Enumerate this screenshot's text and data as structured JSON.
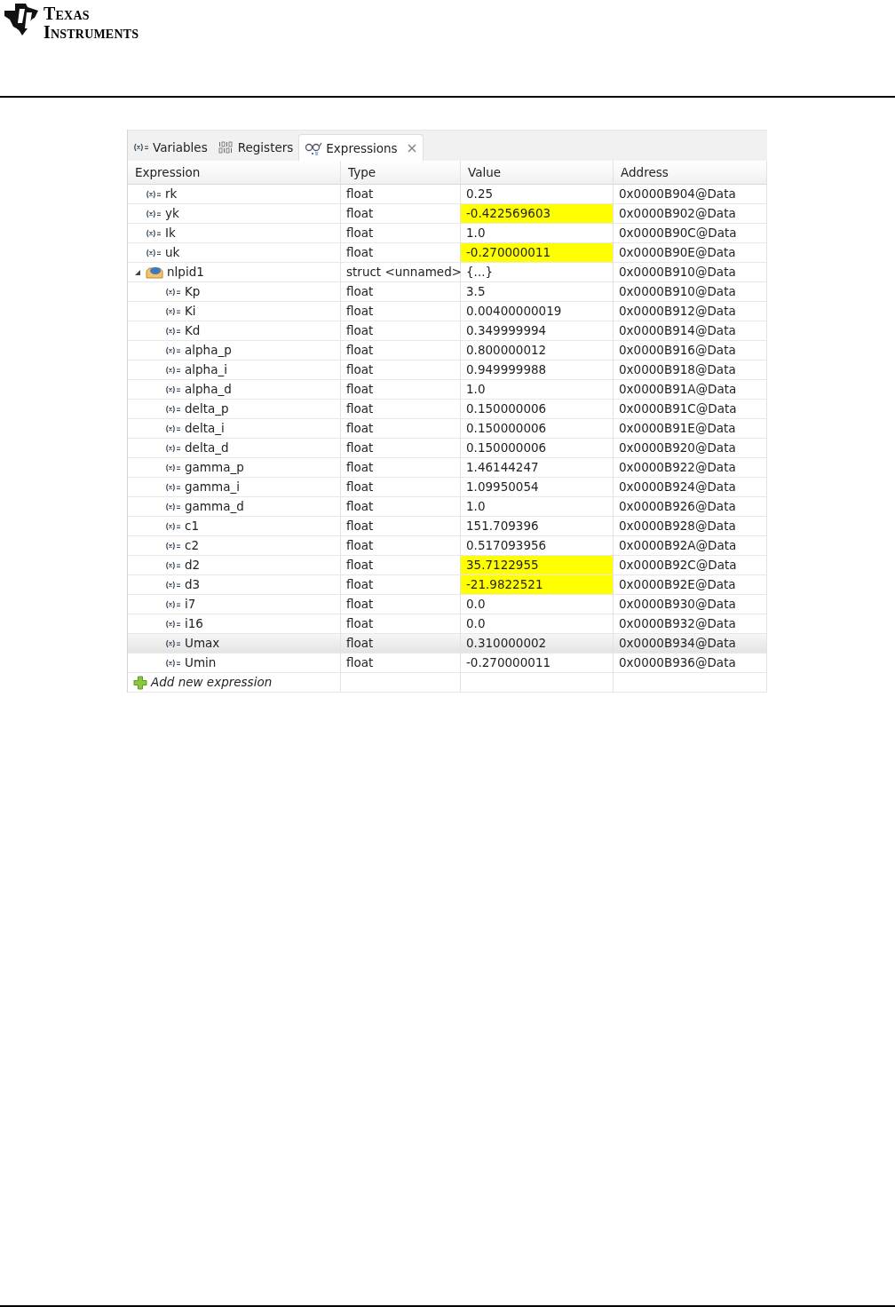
{
  "logo": {
    "line_1": "TEXAS",
    "line_2": "INSTRUMENTS"
  },
  "tabs": [
    {
      "label": "Variables",
      "kind": "variables",
      "selected": false
    },
    {
      "label": "Registers",
      "kind": "registers",
      "selected": false
    },
    {
      "label": "Expressions",
      "kind": "expressions",
      "selected": true
    }
  ],
  "table": {
    "columns": [
      "Expression",
      "Type",
      "Value",
      "Address"
    ],
    "rows": [
      {
        "name": "rk",
        "type": "float",
        "value": "0.25",
        "address": "0x0000B904@Data",
        "changed": false,
        "selected": false
      },
      {
        "name": "yk",
        "type": "float",
        "value": "-0.422569603",
        "address": "0x0000B902@Data",
        "changed": true,
        "selected": false
      },
      {
        "name": "Ik",
        "type": "float",
        "value": "1.0",
        "address": "0x0000B90C@Data",
        "changed": false,
        "selected": false
      },
      {
        "name": "uk",
        "type": "float",
        "value": "-0.270000011",
        "address": "0x0000B90E@Data",
        "changed": true,
        "selected": false
      },
      {
        "name": "nlpid1",
        "type": "struct <unnamed>",
        "value": "{...}",
        "address": "0x0000B910@Data",
        "changed": false,
        "selected": false,
        "expanded": true,
        "children": [
          {
            "name": "Kp",
            "type": "float",
            "value": "3.5",
            "address": "0x0000B910@Data",
            "changed": false,
            "selected": false
          },
          {
            "name": "Ki",
            "type": "float",
            "value": "0.00400000019",
            "address": "0x0000B912@Data",
            "changed": false,
            "selected": false
          },
          {
            "name": "Kd",
            "type": "float",
            "value": "0.349999994",
            "address": "0x0000B914@Data",
            "changed": false,
            "selected": false
          },
          {
            "name": "alpha_p",
            "type": "float",
            "value": "0.800000012",
            "address": "0x0000B916@Data",
            "changed": false,
            "selected": false
          },
          {
            "name": "alpha_i",
            "type": "float",
            "value": "0.949999988",
            "address": "0x0000B918@Data",
            "changed": false,
            "selected": false
          },
          {
            "name": "alpha_d",
            "type": "float",
            "value": "1.0",
            "address": "0x0000B91A@Data",
            "changed": false,
            "selected": false
          },
          {
            "name": "delta_p",
            "type": "float",
            "value": "0.150000006",
            "address": "0x0000B91C@Data",
            "changed": false,
            "selected": false
          },
          {
            "name": "delta_i",
            "type": "float",
            "value": "0.150000006",
            "address": "0x0000B91E@Data",
            "changed": false,
            "selected": false
          },
          {
            "name": "delta_d",
            "type": "float",
            "value": "0.150000006",
            "address": "0x0000B920@Data",
            "changed": false,
            "selected": false
          },
          {
            "name": "gamma_p",
            "type": "float",
            "value": "1.46144247",
            "address": "0x0000B922@Data",
            "changed": false,
            "selected": false
          },
          {
            "name": "gamma_i",
            "type": "float",
            "value": "1.09950054",
            "address": "0x0000B924@Data",
            "changed": false,
            "selected": false
          },
          {
            "name": "gamma_d",
            "type": "float",
            "value": "1.0",
            "address": "0x0000B926@Data",
            "changed": false,
            "selected": false
          },
          {
            "name": "c1",
            "type": "float",
            "value": "151.709396",
            "address": "0x0000B928@Data",
            "changed": false,
            "selected": false
          },
          {
            "name": "c2",
            "type": "float",
            "value": "0.517093956",
            "address": "0x0000B92A@Data",
            "changed": false,
            "selected": false
          },
          {
            "name": "d2",
            "type": "float",
            "value": "35.7122955",
            "address": "0x0000B92C@Data",
            "changed": true,
            "selected": false
          },
          {
            "name": "d3",
            "type": "float",
            "value": "-21.9822521",
            "address": "0x0000B92E@Data",
            "changed": true,
            "selected": false
          },
          {
            "name": "i7",
            "type": "float",
            "value": "0.0",
            "address": "0x0000B930@Data",
            "changed": false,
            "selected": false
          },
          {
            "name": "i16",
            "type": "float",
            "value": "0.0",
            "address": "0x0000B932@Data",
            "changed": false,
            "selected": false
          },
          {
            "name": "Umax",
            "type": "float",
            "value": "0.310000002",
            "address": "0x0000B934@Data",
            "changed": false,
            "selected": true
          },
          {
            "name": "Umin",
            "type": "float",
            "value": "-0.270000011",
            "address": "0x0000B936@Data",
            "changed": false,
            "selected": false
          }
        ]
      }
    ],
    "add_row": "Add new expression"
  }
}
